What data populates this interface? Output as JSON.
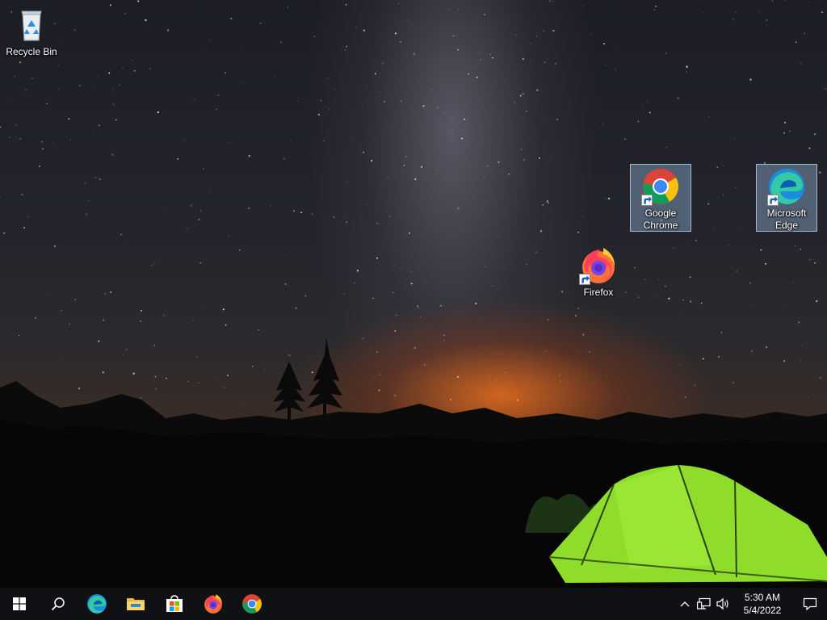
{
  "desktop": {
    "icons": [
      {
        "label": "Recycle Bin",
        "icon": "recycle-bin-icon",
        "selected": false,
        "shortcut": false
      },
      {
        "label": "Google Chrome",
        "icon": "chrome-icon",
        "selected": true,
        "shortcut": true
      },
      {
        "label": "Microsoft Edge",
        "icon": "edge-icon",
        "selected": true,
        "shortcut": true
      },
      {
        "label": "Firefox",
        "icon": "firefox-icon",
        "selected": false,
        "shortcut": true
      }
    ]
  },
  "taskbar": {
    "buttons": [
      {
        "name": "start-button",
        "icon": "windows-logo-icon"
      },
      {
        "name": "search-button",
        "icon": "search-icon"
      },
      {
        "name": "taskbar-edge",
        "icon": "edge-icon"
      },
      {
        "name": "taskbar-file-explorer",
        "icon": "folder-icon"
      },
      {
        "name": "taskbar-store",
        "icon": "store-icon"
      },
      {
        "name": "taskbar-firefox",
        "icon": "firefox-icon"
      },
      {
        "name": "taskbar-chrome",
        "icon": "chrome-icon"
      }
    ],
    "tray": {
      "icons": [
        "chevron-up-icon",
        "network-icon",
        "volume-icon"
      ],
      "time": "5:30 AM",
      "date": "5/4/2022",
      "notification_icon": "notification-icon"
    }
  },
  "colors": {
    "taskbar": "#101114",
    "selection": "#8caacd",
    "tent": "#8fdc2a"
  }
}
